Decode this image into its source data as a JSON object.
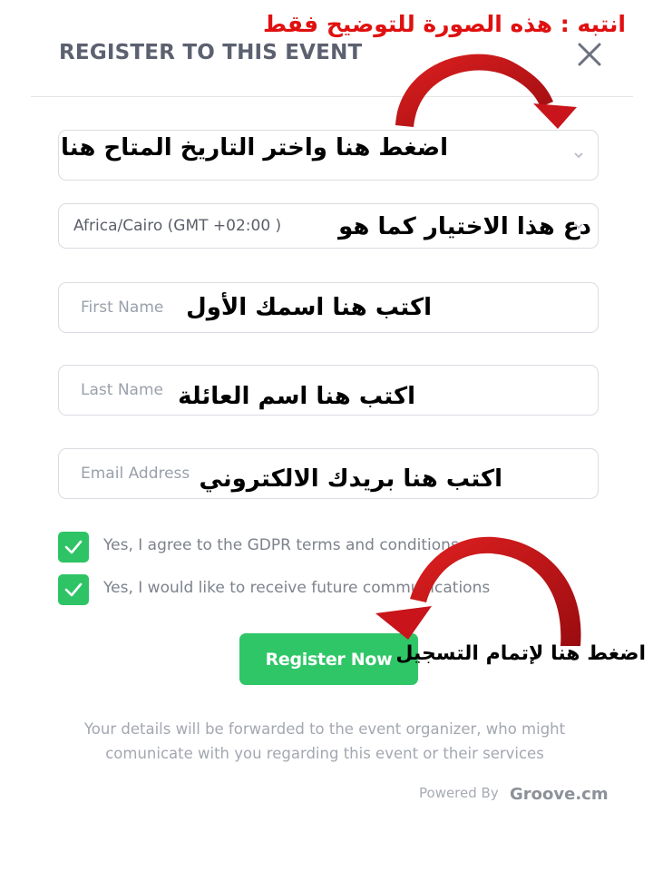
{
  "header": {
    "title": "REGISTER TO THIS EVENT",
    "close_icon": "close-icon"
  },
  "form": {
    "date_select": {
      "value": "",
      "icon": "chevron-down-icon"
    },
    "timezone_select": {
      "value": "Africa/Cairo (GMT +02:00 )",
      "icon": "chevron-down-icon"
    },
    "first_name": {
      "placeholder": "First Name"
    },
    "last_name": {
      "placeholder": "Last Name"
    },
    "email": {
      "placeholder": "Email Address"
    },
    "checkboxes": [
      {
        "label": "Yes, I agree to the GDPR terms and conditions",
        "checked": true
      },
      {
        "label": "Yes, I would like to receive future communications",
        "checked": true
      }
    ],
    "register_label": "Register Now",
    "note": "Your details will be forwarded to the event organizer, who might comunicate with you regarding this event or their services"
  },
  "footer": {
    "powered_by": "Powered By",
    "brand": "Groove.cm"
  },
  "annotations": {
    "warning": "انتبه : هذه الصورة للتوضيح فقط",
    "date_hint": "اضغط هنا واختر التاريخ المتاح هنا",
    "timezone_hint": "دع هذا الاختيار كما هو",
    "first_name_hint": "اكتب هنا اسمك الأول",
    "last_name_hint": "اكتب هنا اسم العائلة",
    "email_hint": "اكتب هنا بريدك الالكتروني",
    "register_hint": "اضغط هنا لإتمام التسجيل"
  },
  "colors": {
    "accent_green": "#2fc667",
    "annotation_red": "#e01010",
    "arrow_red": "#c8141a"
  }
}
